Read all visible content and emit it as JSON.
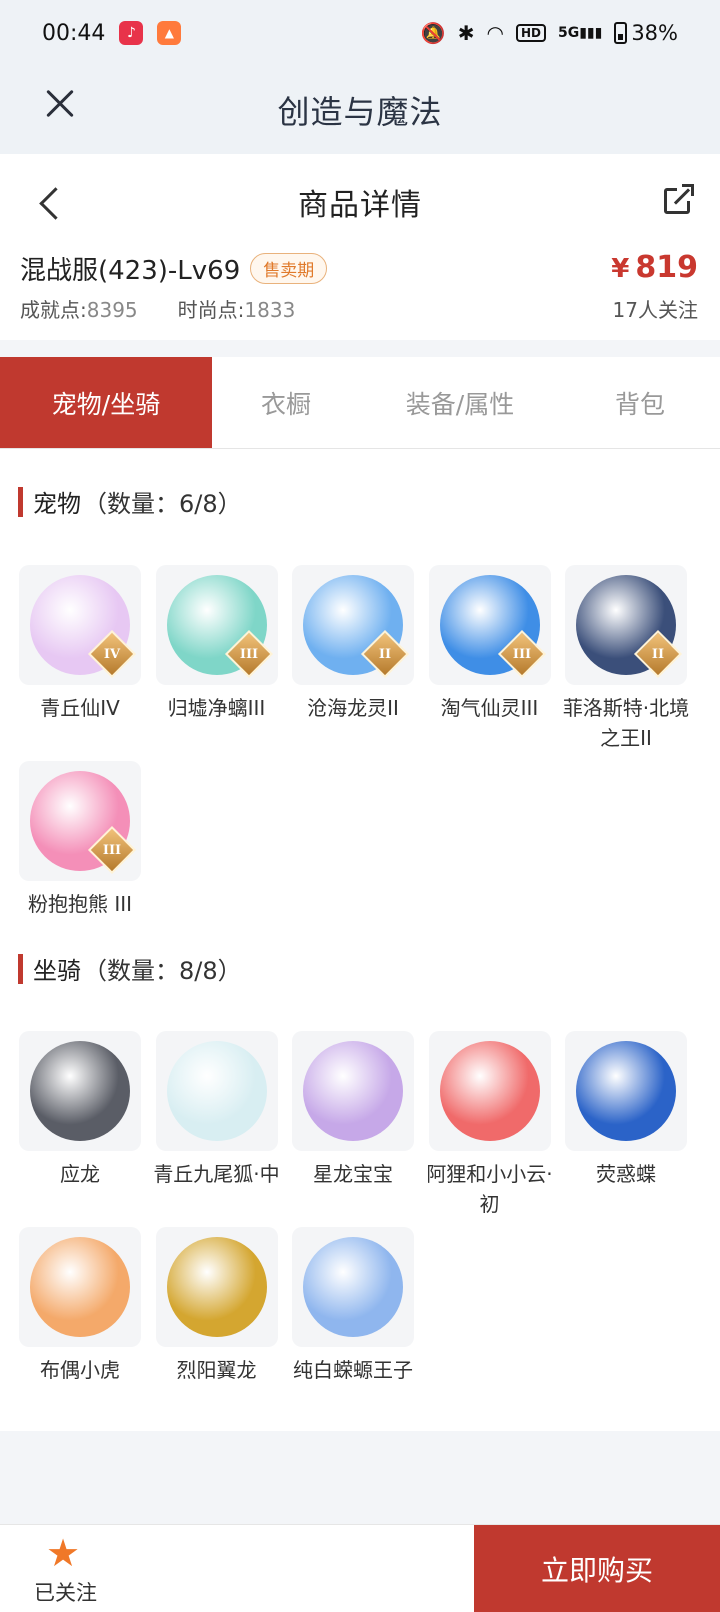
{
  "status": {
    "time": "00:44",
    "battery": "38%",
    "network": "5G",
    "hd": "HD"
  },
  "app": {
    "title": "创造与魔法",
    "close_icon": "close-icon"
  },
  "nav": {
    "title": "商品详情"
  },
  "item": {
    "name": "混战服(423)-Lv69",
    "badge": "售卖期",
    "price_symbol": "¥",
    "price": "819",
    "achievement_label": "成就点:",
    "achievement_value": "8395",
    "fashion_label": "时尚点:",
    "fashion_value": "1833",
    "followers": "17人关注"
  },
  "tabs": [
    {
      "label": "宠物/坐骑",
      "active": true
    },
    {
      "label": "衣橱"
    },
    {
      "label": "装备/属性"
    },
    {
      "label": "背包"
    }
  ],
  "pets": {
    "title": "宠物",
    "count": "（数量：6/8）",
    "items": [
      {
        "label": "青丘仙IV",
        "rank": "IV",
        "color": "#e7c8f3"
      },
      {
        "label": "归墟净螭III",
        "rank": "III",
        "color": "#7fd6c8"
      },
      {
        "label": "沧海龙灵II",
        "rank": "II",
        "color": "#6fb0f0"
      },
      {
        "label": "淘气仙灵III",
        "rank": "III",
        "color": "#3f8ee6"
      },
      {
        "label": "菲洛斯特·北境之王II",
        "rank": "II",
        "color": "#3b4f7a"
      },
      {
        "label": "粉抱抱熊 III",
        "rank": "III",
        "color": "#f48fb8"
      }
    ]
  },
  "mounts": {
    "title": "坐骑",
    "count": "（数量：8/8）",
    "items": [
      {
        "label": "应龙",
        "color": "#5a5d66"
      },
      {
        "label": "青丘九尾狐·中",
        "color": "#d8eef2"
      },
      {
        "label": "星龙宝宝",
        "color": "#c6a8e8"
      },
      {
        "label": "阿狸和小小云·初",
        "color": "#f06a6a"
      },
      {
        "label": "荧惑蝶",
        "color": "#2b63c8"
      },
      {
        "label": "布偶小虎",
        "color": "#f4a96a"
      },
      {
        "label": "烈阳翼龙",
        "color": "#d4a630"
      },
      {
        "label": "纯白蝾螈王子",
        "color": "#8fb6ee"
      }
    ]
  },
  "bottom": {
    "follow_label": "已关注",
    "buy_label": "立即购买"
  }
}
